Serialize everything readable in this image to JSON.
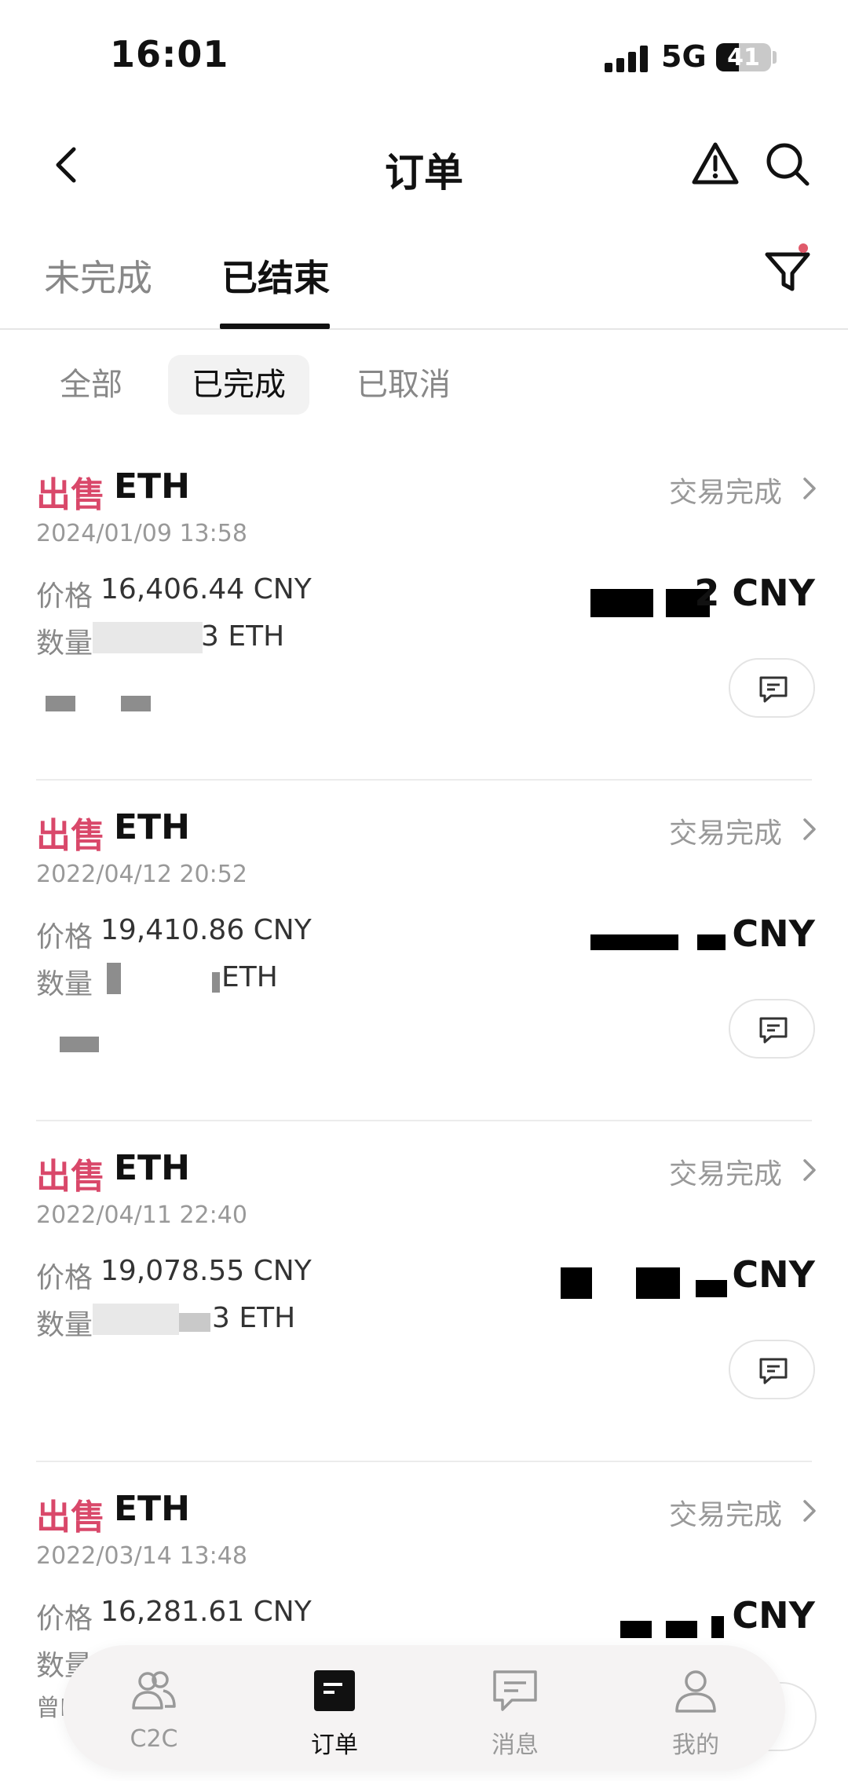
{
  "status_bar": {
    "time": "16:01",
    "network": "5G",
    "battery": "41",
    "battery_level": 0.41
  },
  "header": {
    "title": "订单"
  },
  "main_tabs": [
    {
      "label": "未完成",
      "active": false
    },
    {
      "label": "已结束",
      "active": true
    }
  ],
  "sub_tabs": [
    {
      "label": "全部",
      "active": false
    },
    {
      "label": "已完成",
      "active": true
    },
    {
      "label": "已取消",
      "active": false
    }
  ],
  "orders": [
    {
      "side": "出售",
      "asset": "ETH",
      "status": "交易完成",
      "date": "2024/01/09 13:58",
      "price_label": "价格",
      "price": "16,406.44 CNY",
      "quantity_label": "数量",
      "quantity_value": "3 ETH",
      "amount_value": "2 CNY"
    },
    {
      "side": "出售",
      "asset": "ETH",
      "status": "交易完成",
      "date": "2022/04/12 20:52",
      "price_label": "价格",
      "price": "19,410.86 CNY",
      "quantity_label": "数量",
      "quantity_value": "ETH",
      "amount_value": "CNY"
    },
    {
      "side": "出售",
      "asset": "ETH",
      "status": "交易完成",
      "date": "2022/04/11 22:40",
      "price_label": "价格",
      "price": "19,078.55 CNY",
      "quantity_label": "数量",
      "quantity_value": "3 ETH",
      "amount_value": "CNY"
    },
    {
      "side": "出售",
      "asset": "ETH",
      "status": "交易完成",
      "date": "2022/03/14 13:48",
      "price_label": "价格",
      "price": "16,281.61 CNY",
      "quantity_label": "数量",
      "quantity_value": "",
      "amount_value": "CNY",
      "note_prefix": "曾E"
    }
  ],
  "bottom_nav": [
    {
      "label": "C2C",
      "icon": "users-icon",
      "active": false
    },
    {
      "label": "订单",
      "icon": "orders-icon",
      "active": true
    },
    {
      "label": "消息",
      "icon": "message-icon",
      "active": false
    },
    {
      "label": "我的",
      "icon": "profile-icon",
      "active": false
    }
  ],
  "colors": {
    "sell": "#d9486a",
    "muted": "#999999",
    "text": "#111111",
    "nav_bg": "#f5f3f3"
  }
}
